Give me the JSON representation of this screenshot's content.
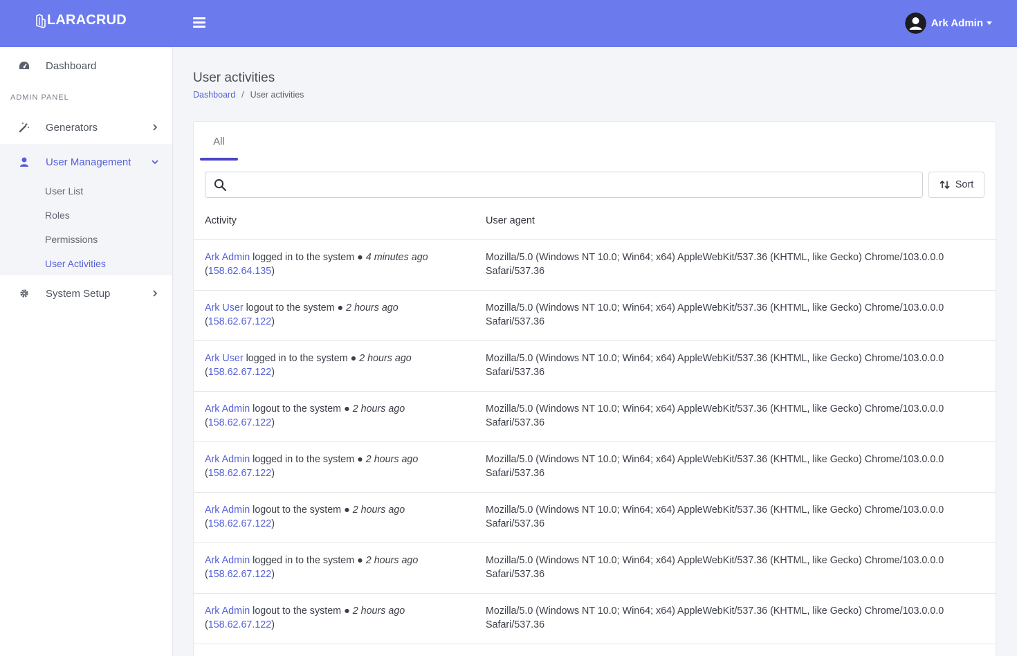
{
  "app": {
    "brand": "LARACRUD",
    "user_name": "Ark Admin"
  },
  "sidebar": {
    "dashboard": "Dashboard",
    "section_label": "ADMIN PANEL",
    "generators": "Generators",
    "user_management": "User Management",
    "sub_items": [
      "User List",
      "Roles",
      "Permissions",
      "User Activities"
    ],
    "system_setup": "System Setup"
  },
  "page": {
    "title": "User activities",
    "breadcrumb": {
      "home": "Dashboard",
      "separator": "/",
      "current": "User activities"
    }
  },
  "tabs": [
    {
      "label": "All",
      "active": true
    }
  ],
  "search": {
    "value": "",
    "placeholder": ""
  },
  "sort_label": "Sort",
  "table": {
    "columns": [
      "Activity",
      "User agent"
    ],
    "rows": [
      {
        "user": "Ark Admin",
        "action": "logged in to the system",
        "bullet": "●",
        "time": "4 minutes ago",
        "ip": "158.62.64.135",
        "agent_line1": "Mozilla/5.0 (Windows NT 10.0; Win64; x64) AppleWebKit/537.36 (KHTML, like Gecko) Chrome/103.0.0.0",
        "agent_line2": "Safari/537.36"
      },
      {
        "user": "Ark User",
        "action": "logout to the system",
        "bullet": "●",
        "time": "2 hours ago",
        "ip": "158.62.67.122",
        "agent_line1": "Mozilla/5.0 (Windows NT 10.0; Win64; x64) AppleWebKit/537.36 (KHTML, like Gecko) Chrome/103.0.0.0",
        "agent_line2": "Safari/537.36"
      },
      {
        "user": "Ark User",
        "action": "logged in to the system",
        "bullet": "●",
        "time": "2 hours ago",
        "ip": "158.62.67.122",
        "agent_line1": "Mozilla/5.0 (Windows NT 10.0; Win64; x64) AppleWebKit/537.36 (KHTML, like Gecko) Chrome/103.0.0.0",
        "agent_line2": "Safari/537.36"
      },
      {
        "user": "Ark Admin",
        "action": "logout to the system",
        "bullet": "●",
        "time": "2 hours ago",
        "ip": "158.62.67.122",
        "agent_line1": "Mozilla/5.0 (Windows NT 10.0; Win64; x64) AppleWebKit/537.36 (KHTML, like Gecko) Chrome/103.0.0.0",
        "agent_line2": "Safari/537.36"
      },
      {
        "user": "Ark Admin",
        "action": "logged in to the system",
        "bullet": "●",
        "time": "2 hours ago",
        "ip": "158.62.67.122",
        "agent_line1": "Mozilla/5.0 (Windows NT 10.0; Win64; x64) AppleWebKit/537.36 (KHTML, like Gecko) Chrome/103.0.0.0",
        "agent_line2": "Safari/537.36"
      },
      {
        "user": "Ark Admin",
        "action": "logout to the system",
        "bullet": "●",
        "time": "2 hours ago",
        "ip": "158.62.67.122",
        "agent_line1": "Mozilla/5.0 (Windows NT 10.0; Win64; x64) AppleWebKit/537.36 (KHTML, like Gecko) Chrome/103.0.0.0",
        "agent_line2": "Safari/537.36"
      },
      {
        "user": "Ark Admin",
        "action": "logged in to the system",
        "bullet": "●",
        "time": "2 hours ago",
        "ip": "158.62.67.122",
        "agent_line1": "Mozilla/5.0 (Windows NT 10.0; Win64; x64) AppleWebKit/537.36 (KHTML, like Gecko) Chrome/103.0.0.0",
        "agent_line2": "Safari/537.36"
      },
      {
        "user": "Ark Admin",
        "action": "logout to the system",
        "bullet": "●",
        "time": "2 hours ago",
        "ip": "158.62.67.122",
        "agent_line1": "Mozilla/5.0 (Windows NT 10.0; Win64; x64) AppleWebKit/537.36 (KHTML, like Gecko) Chrome/103.0.0.0",
        "agent_line2": "Safari/537.36"
      }
    ]
  },
  "icons": {
    "menu": "hamburger-menu-icon",
    "dashboard": "speedometer-icon",
    "generators": "magic-wand-icon",
    "user_management": "person-icon",
    "system_setup": "gear-icon",
    "search": "search-icon",
    "sort": "sort-arrows-icon"
  },
  "colors": {
    "topbar": "#6b7aed",
    "accent": "#5561d9",
    "tab_underline": "#4b44c8"
  }
}
